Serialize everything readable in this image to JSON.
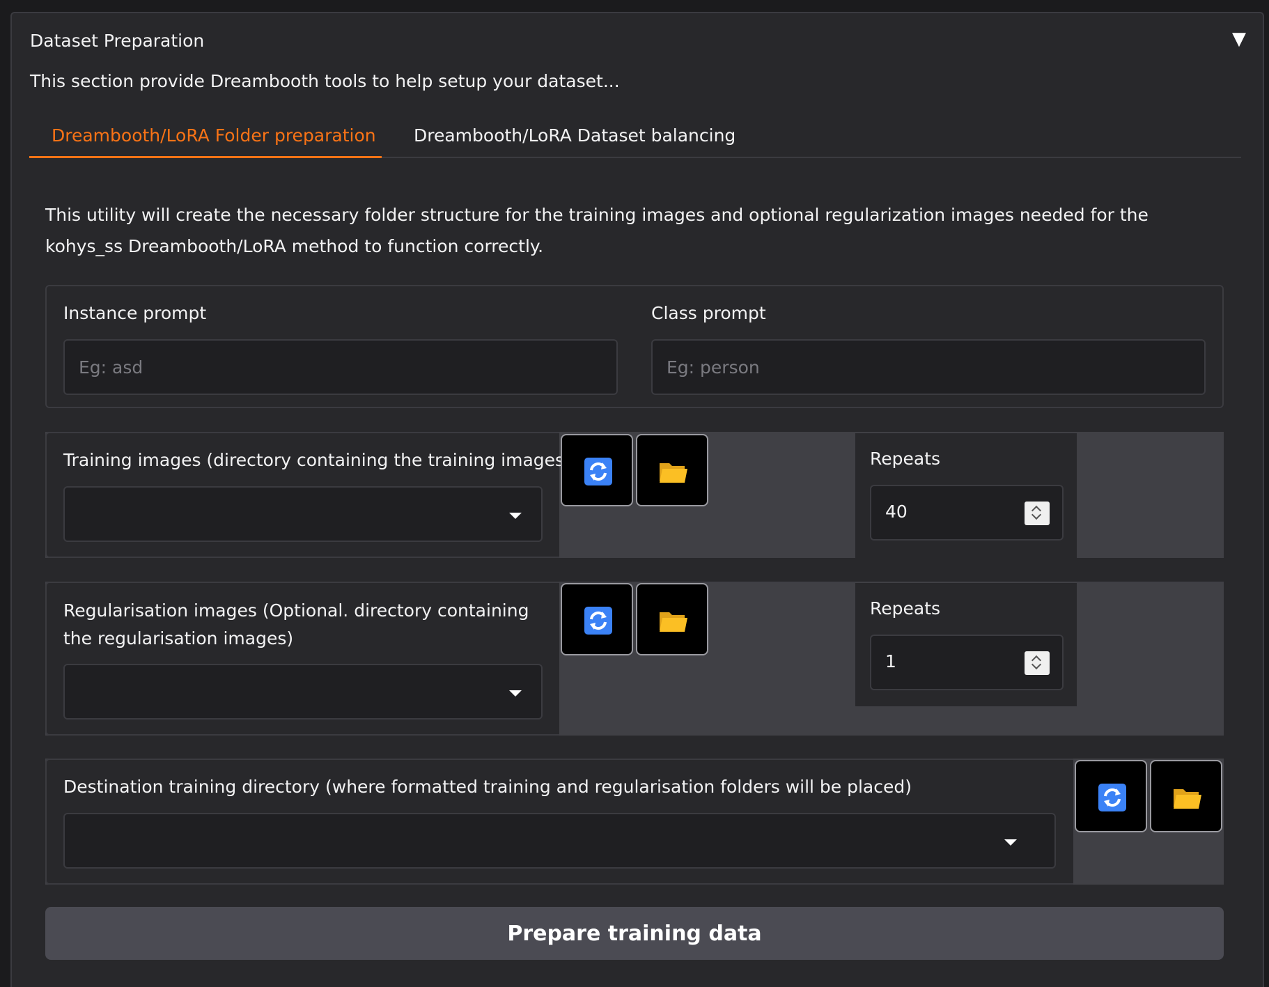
{
  "accordion": {
    "title": "Dataset Preparation",
    "toggle_icon": "▼",
    "description": "This section provide Dreambooth tools to help setup your dataset..."
  },
  "tabs": [
    {
      "label": "Dreambooth/LoRA Folder preparation",
      "active": true
    },
    {
      "label": "Dreambooth/LoRA Dataset balancing",
      "active": false
    }
  ],
  "utility_description": "This utility will create the necessary folder structure for the training images and optional regularization images needed for the kohys_ss Dreambooth/LoRA method to function correctly.",
  "prompts": {
    "instance_label": "Instance prompt",
    "instance_placeholder": "Eg: asd",
    "class_label": "Class prompt",
    "class_placeholder": "Eg: person"
  },
  "training": {
    "label": "Training images (directory containing the training images)",
    "value": "",
    "repeats_label": "Repeats",
    "repeats_value": "40"
  },
  "regularisation": {
    "label": "Regularisation images (Optional. directory containing the regularisation images)",
    "value": "",
    "repeats_label": "Repeats",
    "repeats_value": "1"
  },
  "destination": {
    "label": "Destination training directory (where formatted training and regularisation folders will be placed)",
    "value": ""
  },
  "icons": {
    "refresh": "refresh-icon",
    "folder": "folder-icon"
  },
  "colors": {
    "accent": "#f97316",
    "refresh_blue": "#3b82f6",
    "folder_yellow": "#fbbf24"
  },
  "prepare_button": "Prepare training data"
}
